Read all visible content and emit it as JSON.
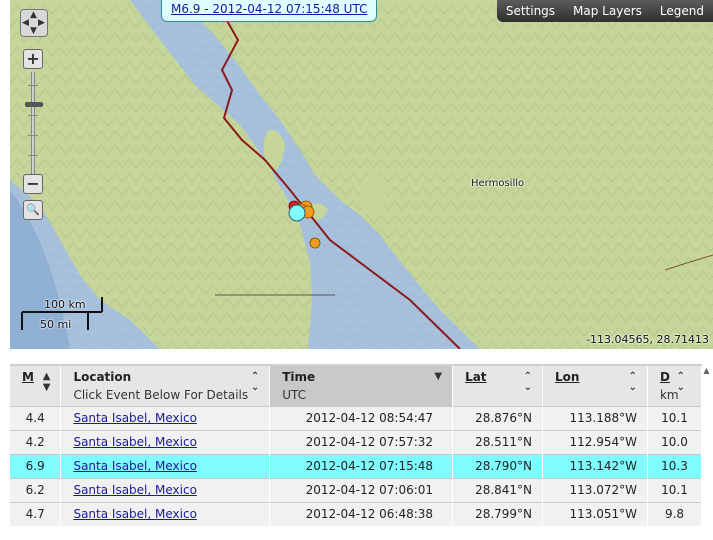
{
  "map": {
    "popup_label": "M6.9 - 2012-04-12 07:15:48 UTC",
    "toolbar": {
      "settings": "Settings",
      "map_layers": "Map Layers",
      "legend": "Legend"
    },
    "zoom_in": "+",
    "zoom_out": "−",
    "city": "Hermosillo",
    "scale_km": "100 km",
    "scale_mi": "50 mi",
    "coordinates": "-113.04565, 28.71413",
    "icons": {
      "pan": "pan-arrows-icon",
      "extent": "magnifier-icon"
    },
    "colors": {
      "water": "#a7c1dc",
      "land": "#c6d69b",
      "fault": "#8b1a1a",
      "selected": "#7ffcff",
      "marker_orange": "#f39a1a",
      "marker_red": "#d81d1d"
    }
  },
  "table": {
    "columns": [
      {
        "key": "m",
        "label": "M",
        "sub": ""
      },
      {
        "key": "location",
        "label": "Location",
        "sub": "Click Event Below For Details"
      },
      {
        "key": "time",
        "label": "Time",
        "sub": "UTC"
      },
      {
        "key": "lat",
        "label": "Lat",
        "sub": ""
      },
      {
        "key": "lon",
        "label": "Lon",
        "sub": ""
      },
      {
        "key": "d",
        "label": "D",
        "sub": "km"
      }
    ],
    "rows": [
      {
        "m": "4.4",
        "location": "Santa Isabel, Mexico",
        "time": "2012-04-12 08:54:47",
        "lat": "28.876°N",
        "lon": "113.188°W",
        "d": "10.1",
        "selected": false
      },
      {
        "m": "4.2",
        "location": "Santa Isabel, Mexico",
        "time": "2012-04-12 07:57:32",
        "lat": "28.511°N",
        "lon": "112.954°W",
        "d": "10.0",
        "selected": false
      },
      {
        "m": "6.9",
        "location": "Santa Isabel, Mexico",
        "time": "2012-04-12 07:15:48",
        "lat": "28.790°N",
        "lon": "113.142°W",
        "d": "10.3",
        "selected": true
      },
      {
        "m": "6.2",
        "location": "Santa Isabel, Mexico",
        "time": "2012-04-12 07:06:01",
        "lat": "28.841°N",
        "lon": "113.072°W",
        "d": "10.1",
        "selected": false
      },
      {
        "m": "4.7",
        "location": "Santa Isabel, Mexico",
        "time": "2012-04-12 06:48:38",
        "lat": "28.799°N",
        "lon": "113.051°W",
        "d": "9.8",
        "selected": false
      }
    ]
  }
}
